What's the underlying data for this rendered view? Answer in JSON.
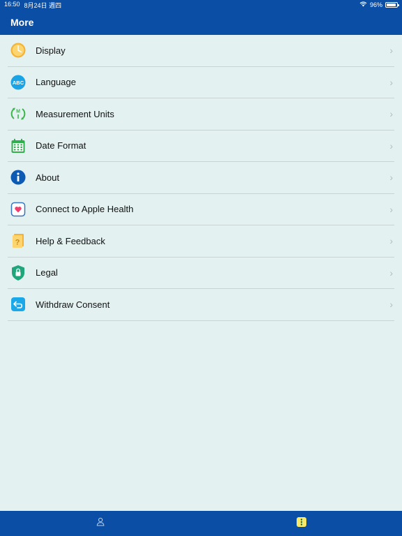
{
  "status_bar": {
    "time": "16:50",
    "date": "8月24日 週四",
    "battery": "96%",
    "battery_level": 0.96
  },
  "header": {
    "title": "More"
  },
  "menu": {
    "items": [
      {
        "label": "Display",
        "icon": "clock-icon"
      },
      {
        "label": "Language",
        "icon": "abc-icon"
      },
      {
        "label": "Measurement Units",
        "icon": "measurement-icon"
      },
      {
        "label": "Date Format",
        "icon": "calendar-icon"
      },
      {
        "label": "About",
        "icon": "info-icon"
      },
      {
        "label": "Connect to Apple Health",
        "icon": "heart-icon"
      },
      {
        "label": "Help & Feedback",
        "icon": "help-book-icon"
      },
      {
        "label": "Legal",
        "icon": "shield-lock-icon"
      },
      {
        "label": "Withdraw Consent",
        "icon": "return-arrow-icon"
      }
    ]
  },
  "tab_bar": {
    "tabs": [
      {
        "name": "profile",
        "icon": "person-icon"
      },
      {
        "name": "more",
        "icon": "more-icon",
        "active": true
      }
    ]
  },
  "colors": {
    "brand": "#0b4ea5",
    "background": "#e3f1f1",
    "divider": "#c9d3d3"
  }
}
